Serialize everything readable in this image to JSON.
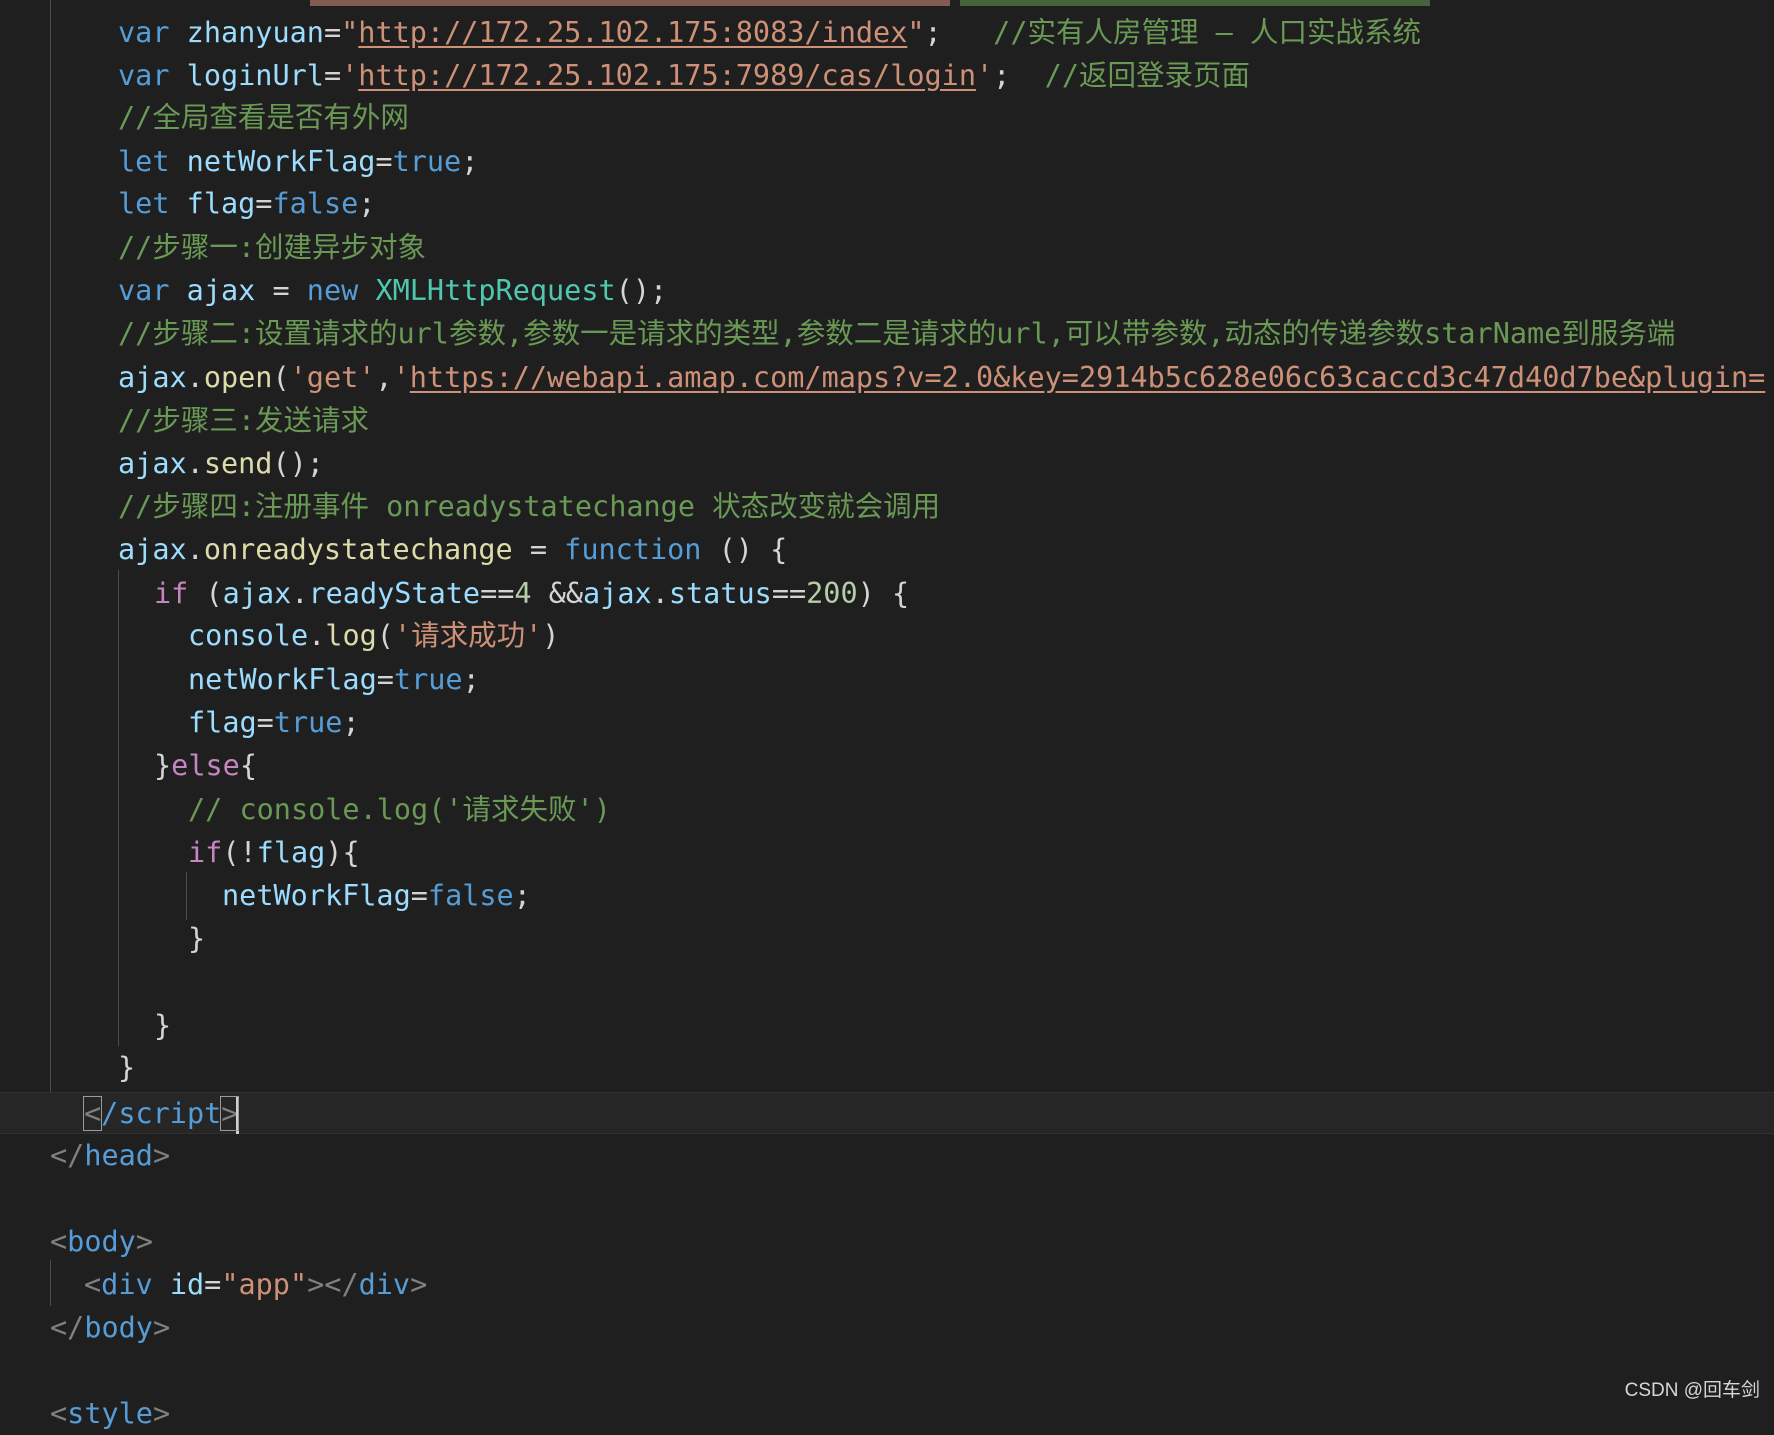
{
  "editor": {
    "top_clipped_line": "",
    "lines": [
      {
        "id": "l1",
        "parts": [
          {
            "t": "var",
            "c": "k-blue"
          },
          {
            "t": " ",
            "c": ""
          },
          {
            "t": "zhanyuan",
            "c": "k-var"
          },
          {
            "t": "=",
            "c": ""
          },
          {
            "t": "\"",
            "c": "k-str"
          },
          {
            "t": "http://172.25.102.175:8083/index",
            "c": "k-str url"
          },
          {
            "t": "\"",
            "c": "k-str"
          },
          {
            "t": ";   ",
            "c": ""
          },
          {
            "t": "//实有人房管理 – 人口实战系统",
            "c": "k-com"
          }
        ]
      },
      {
        "id": "l2",
        "parts": [
          {
            "t": "var",
            "c": "k-blue"
          },
          {
            "t": " ",
            "c": ""
          },
          {
            "t": "loginUrl",
            "c": "k-var"
          },
          {
            "t": "=",
            "c": ""
          },
          {
            "t": "'",
            "c": "k-str"
          },
          {
            "t": "http://172.25.102.175:7989/cas/login",
            "c": "k-str url"
          },
          {
            "t": "'",
            "c": "k-str"
          },
          {
            "t": ";  ",
            "c": ""
          },
          {
            "t": "//返回登录页面",
            "c": "k-com"
          }
        ]
      },
      {
        "id": "l3",
        "parts": [
          {
            "t": "//全局查看是否有外网",
            "c": "k-com"
          }
        ]
      },
      {
        "id": "l4",
        "parts": [
          {
            "t": "let",
            "c": "k-blue"
          },
          {
            "t": " ",
            "c": ""
          },
          {
            "t": "netWorkFlag",
            "c": "k-var"
          },
          {
            "t": "=",
            "c": ""
          },
          {
            "t": "true",
            "c": "k-blue"
          },
          {
            "t": ";",
            "c": ""
          }
        ]
      },
      {
        "id": "l5",
        "parts": [
          {
            "t": "let",
            "c": "k-blue"
          },
          {
            "t": " ",
            "c": ""
          },
          {
            "t": "flag",
            "c": "k-var"
          },
          {
            "t": "=",
            "c": ""
          },
          {
            "t": "false",
            "c": "k-blue"
          },
          {
            "t": ";",
            "c": ""
          }
        ]
      },
      {
        "id": "l6",
        "parts": [
          {
            "t": "//步骤一:创建异步对象",
            "c": "k-com"
          }
        ]
      },
      {
        "id": "l7",
        "parts": [
          {
            "t": "var",
            "c": "k-blue"
          },
          {
            "t": " ",
            "c": ""
          },
          {
            "t": "ajax",
            "c": "k-var"
          },
          {
            "t": " = ",
            "c": ""
          },
          {
            "t": "new",
            "c": "k-blue"
          },
          {
            "t": " ",
            "c": ""
          },
          {
            "t": "XMLHttpRequest",
            "c": "k-type"
          },
          {
            "t": "();",
            "c": ""
          }
        ]
      },
      {
        "id": "l8",
        "parts": [
          {
            "t": "//步骤二:设置请求的url参数,参数一是请求的类型,参数二是请求的url,可以带参数,动态的传递参数starName到服务端",
            "c": "k-com"
          }
        ]
      },
      {
        "id": "l9",
        "parts": [
          {
            "t": "ajax",
            "c": "k-var"
          },
          {
            "t": ".",
            "c": ""
          },
          {
            "t": "open",
            "c": "k-fn"
          },
          {
            "t": "(",
            "c": ""
          },
          {
            "t": "'get'",
            "c": "k-str"
          },
          {
            "t": ",",
            "c": ""
          },
          {
            "t": "'",
            "c": "k-str"
          },
          {
            "t": "https://webapi.amap.com/maps?v=2.0&key=2914b5c628e06c63caccd3c47d40d7be&plugin=",
            "c": "k-str url"
          }
        ]
      },
      {
        "id": "l10",
        "parts": [
          {
            "t": "//步骤三:发送请求",
            "c": "k-com"
          }
        ]
      },
      {
        "id": "l11",
        "parts": [
          {
            "t": "ajax",
            "c": "k-var"
          },
          {
            "t": ".",
            "c": ""
          },
          {
            "t": "send",
            "c": "k-fn"
          },
          {
            "t": "();",
            "c": ""
          }
        ]
      },
      {
        "id": "l12",
        "parts": [
          {
            "t": "//步骤四:注册事件 onreadystatechange 状态改变就会调用",
            "c": "k-com"
          }
        ]
      },
      {
        "id": "l13",
        "parts": [
          {
            "t": "ajax",
            "c": "k-var"
          },
          {
            "t": ".",
            "c": ""
          },
          {
            "t": "onreadystatechange",
            "c": "k-fn"
          },
          {
            "t": " = ",
            "c": ""
          },
          {
            "t": "function",
            "c": "k-blue"
          },
          {
            "t": " () {",
            "c": ""
          }
        ]
      },
      {
        "id": "l14",
        "parts": [
          {
            "t": "if",
            "c": "k-purple"
          },
          {
            "t": " (",
            "c": ""
          },
          {
            "t": "ajax",
            "c": "k-var"
          },
          {
            "t": ".",
            "c": ""
          },
          {
            "t": "readyState",
            "c": "k-var"
          },
          {
            "t": "==",
            "c": ""
          },
          {
            "t": "4",
            "c": "k-num"
          },
          {
            "t": " &&",
            "c": ""
          },
          {
            "t": "ajax",
            "c": "k-var"
          },
          {
            "t": ".",
            "c": ""
          },
          {
            "t": "status",
            "c": "k-var"
          },
          {
            "t": "==",
            "c": ""
          },
          {
            "t": "200",
            "c": "k-num"
          },
          {
            "t": ") {",
            "c": ""
          }
        ]
      },
      {
        "id": "l15",
        "parts": [
          {
            "t": "console",
            "c": "k-var"
          },
          {
            "t": ".",
            "c": ""
          },
          {
            "t": "log",
            "c": "k-fn"
          },
          {
            "t": "(",
            "c": ""
          },
          {
            "t": "'请求成功'",
            "c": "k-str"
          },
          {
            "t": ")",
            "c": ""
          }
        ]
      },
      {
        "id": "l16",
        "parts": [
          {
            "t": "netWorkFlag",
            "c": "k-var"
          },
          {
            "t": "=",
            "c": ""
          },
          {
            "t": "true",
            "c": "k-blue"
          },
          {
            "t": ";",
            "c": ""
          }
        ]
      },
      {
        "id": "l17",
        "parts": [
          {
            "t": "flag",
            "c": "k-var"
          },
          {
            "t": "=",
            "c": ""
          },
          {
            "t": "true",
            "c": "k-blue"
          },
          {
            "t": ";",
            "c": ""
          }
        ]
      },
      {
        "id": "l18",
        "parts": [
          {
            "t": "}",
            "c": ""
          },
          {
            "t": "else",
            "c": "k-purple"
          },
          {
            "t": "{",
            "c": ""
          }
        ]
      },
      {
        "id": "l19",
        "parts": [
          {
            "t": "// console.log('请求失败')",
            "c": "k-com"
          }
        ]
      },
      {
        "id": "l20",
        "parts": [
          {
            "t": "if",
            "c": "k-purple"
          },
          {
            "t": "(!",
            "c": ""
          },
          {
            "t": "flag",
            "c": "k-var"
          },
          {
            "t": "){",
            "c": ""
          }
        ]
      },
      {
        "id": "l21",
        "parts": [
          {
            "t": "netWorkFlag",
            "c": "k-var"
          },
          {
            "t": "=",
            "c": ""
          },
          {
            "t": "false",
            "c": "k-blue"
          },
          {
            "t": ";",
            "c": ""
          }
        ]
      },
      {
        "id": "l22",
        "parts": [
          {
            "t": "}",
            "c": ""
          }
        ]
      },
      {
        "id": "l23",
        "parts": []
      },
      {
        "id": "l24",
        "parts": [
          {
            "t": "}",
            "c": ""
          }
        ]
      },
      {
        "id": "l25",
        "parts": [
          {
            "t": "}",
            "c": ""
          }
        ]
      },
      {
        "id": "l26",
        "parts": [
          {
            "t": "<",
            "c": "k-punc bracket-box"
          },
          {
            "t": "/script",
            "c": "k-tag"
          },
          {
            "t": ">",
            "c": "k-punc bracket-box"
          }
        ]
      },
      {
        "id": "l27",
        "parts": [
          {
            "t": "</",
            "c": "k-punc"
          },
          {
            "t": "head",
            "c": "k-tag"
          },
          {
            "t": ">",
            "c": "k-punc"
          }
        ]
      },
      {
        "id": "l28",
        "parts": []
      },
      {
        "id": "l29",
        "parts": [
          {
            "t": "<",
            "c": "k-punc"
          },
          {
            "t": "body",
            "c": "k-tag"
          },
          {
            "t": ">",
            "c": "k-punc"
          }
        ]
      },
      {
        "id": "l30",
        "parts": [
          {
            "t": "<",
            "c": "k-punc"
          },
          {
            "t": "div",
            "c": "k-tag"
          },
          {
            "t": " ",
            "c": ""
          },
          {
            "t": "id",
            "c": "k-attr"
          },
          {
            "t": "=",
            "c": ""
          },
          {
            "t": "\"app\"",
            "c": "k-str"
          },
          {
            "t": "></",
            "c": "k-punc"
          },
          {
            "t": "div",
            "c": "k-tag"
          },
          {
            "t": ">",
            "c": "k-punc"
          }
        ]
      },
      {
        "id": "l31",
        "parts": [
          {
            "t": "</",
            "c": "k-punc"
          },
          {
            "t": "body",
            "c": "k-tag"
          },
          {
            "t": ">",
            "c": "k-punc"
          }
        ]
      },
      {
        "id": "l32",
        "parts": []
      },
      {
        "id": "l33",
        "parts": [
          {
            "t": "<",
            "c": "k-punc"
          },
          {
            "t": "style",
            "c": "k-tag"
          },
          {
            "t": ">",
            "c": "k-punc"
          }
        ]
      }
    ]
  },
  "watermark": "CSDN @回车剑",
  "colors": {
    "background": "#1f1f1f",
    "keyword": "#569cd6",
    "control": "#c586c0",
    "variable": "#9cdcfe",
    "function": "#dcdcaa",
    "type": "#4ec9b0",
    "string": "#ce9178",
    "number": "#b5cea8",
    "comment": "#6a9955"
  }
}
